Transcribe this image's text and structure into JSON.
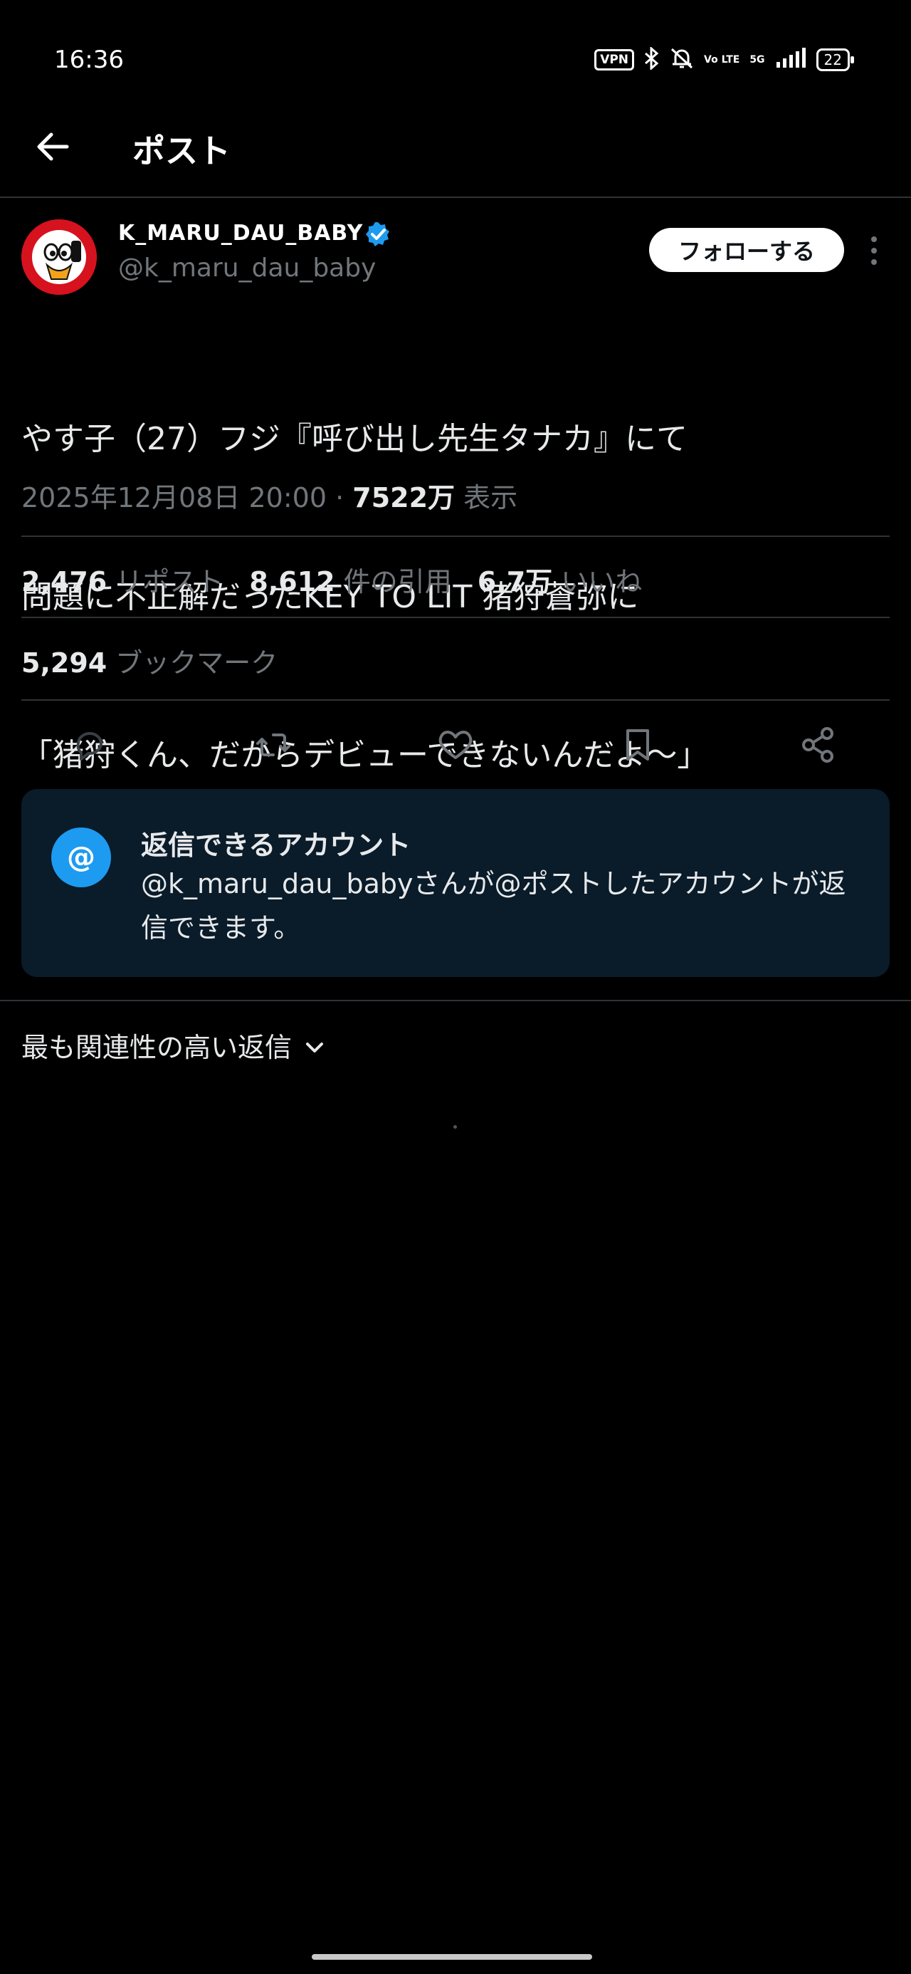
{
  "status_bar": {
    "time": "16:36",
    "vpn": "VPN",
    "volte": "Vo LTE",
    "network": "5G",
    "battery": "22"
  },
  "header": {
    "title": "ポスト"
  },
  "post": {
    "display_name": "K_MARU_DAU_BABY",
    "handle": "@k_maru_dau_baby",
    "follow_label": "フォローする",
    "text_lines": [
      "やす子（27）フジ『呼び出し先生タナカ』にて",
      "問題に不正解だったKEY TO LIT 猪狩蒼弥に",
      "「猪狩くん、だからデビューできないんだよ〜」"
    ],
    "timestamp": "2025年12月08日 20:00",
    "meta_separator": "·",
    "views_count": "7522万",
    "views_label": "表示"
  },
  "stats": {
    "reposts": "2,476",
    "reposts_label": "リポスト",
    "quotes": "8,612",
    "quotes_label": "件の引用",
    "likes": "6.7万",
    "likes_label": "いいね",
    "bookmarks": "5,294",
    "bookmarks_label": "ブックマーク"
  },
  "actions": [
    "reply-icon",
    "repost-icon",
    "like-icon",
    "bookmark-icon",
    "share-icon"
  ],
  "reply_restriction": {
    "icon": "@",
    "title": "返信できるアカウント",
    "description": "@k_maru_dau_babyさんが@ポストしたアカウントが返信できます。"
  },
  "replies": {
    "sort_label": "最も関連性の高い返信"
  },
  "colors": {
    "background": "#000000",
    "accent": "#1d9bf0",
    "muted": "#71767b",
    "reply_box": "#0a1b2a",
    "avatar": "#d6121f"
  }
}
